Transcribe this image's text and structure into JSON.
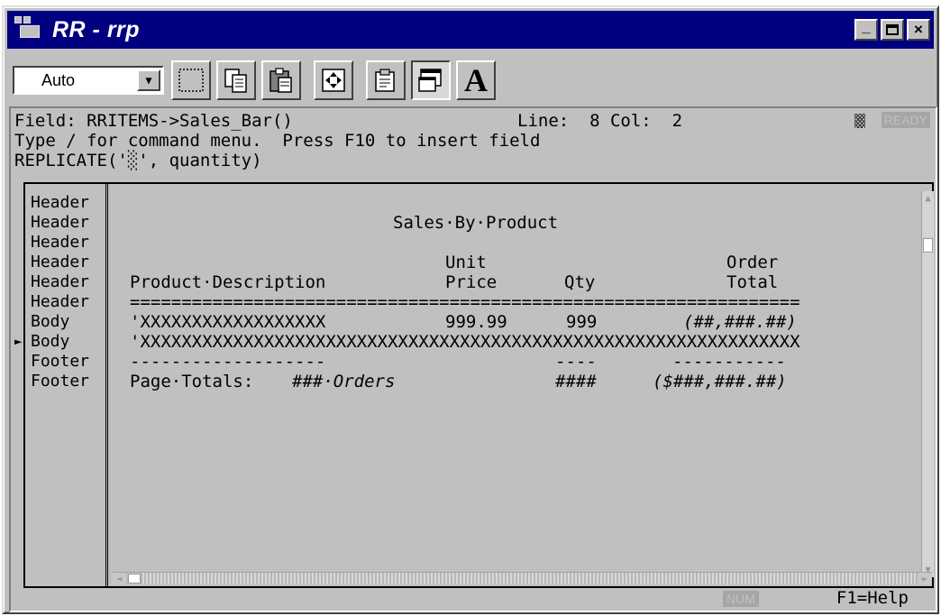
{
  "window": {
    "title": "RR - rrp",
    "title_bar_color": "#000080",
    "minimize_label": "_",
    "close_label": "×"
  },
  "toolbar": {
    "font_select_value": "Auto",
    "buttons": [
      {
        "name": "mark-block-icon"
      },
      {
        "name": "copy-icon"
      },
      {
        "name": "paste-icon"
      },
      {
        "name": "full-screen-icon"
      },
      {
        "name": "properties-icon"
      },
      {
        "name": "background-icon",
        "pressed": true
      },
      {
        "name": "font-icon",
        "label": "A"
      }
    ]
  },
  "status": {
    "field_line": "Field: RRITEMS->Sales_Bar()",
    "position": "Line:  8 Col:  2",
    "hint": "Type / for command menu.  Press F10 to insert field",
    "expression": "REPLICATE('░', quantity)",
    "ready_badge": "READY"
  },
  "bands": [
    {
      "label": "Header"
    },
    {
      "label": "Header"
    },
    {
      "label": "Header"
    },
    {
      "label": "Header"
    },
    {
      "label": "Header"
    },
    {
      "label": "Header"
    },
    {
      "label": "Body"
    },
    {
      "label": "Body",
      "current": true
    },
    {
      "label": "Footer"
    },
    {
      "label": "Footer"
    }
  ],
  "current_marker": "►",
  "report": {
    "title": "Sales·By·Product",
    "unit_label": "Unit",
    "order_label": "Order",
    "desc_header": "Product·Description",
    "price_header": "Price",
    "qty_header": "Qty",
    "total_header": "Total",
    "separator": "=================================================================",
    "body_desc": "'XXXXXXXXXXXXXXXXXX",
    "body_price": "999.99",
    "body_qty": "999",
    "body_total": "(##,###.##)",
    "body_line2": "'XXXXXXXXXXXXXXXXXXXXXXXXXXXXXXXXXXXXXXXXXXXXXXXXXXXXXXXXXXXXXXXX",
    "footer_dash_desc": "-------------------",
    "footer_dash_qty": "----",
    "footer_dash_total": "-----------",
    "totals_label": "Page·Totals:",
    "orders_count": "###·Orders",
    "qty_total": "####",
    "grand_total": "($###,###.##)"
  },
  "footer": {
    "num_badge": "NUM",
    "help": "F1=Help"
  }
}
